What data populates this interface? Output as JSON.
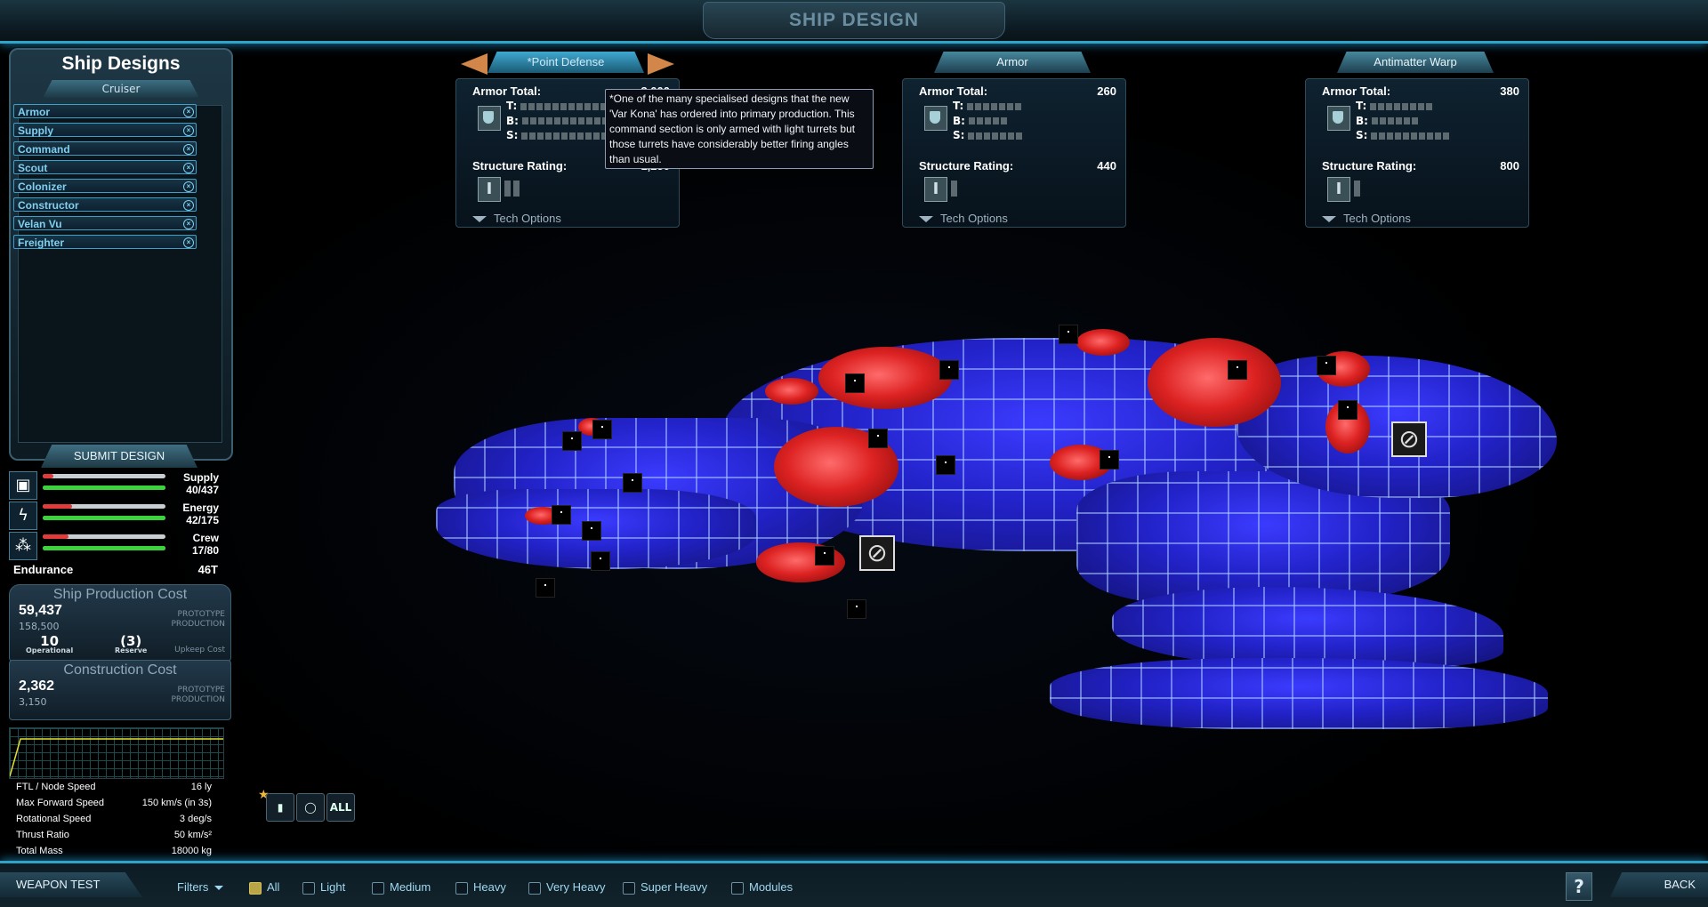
{
  "window": {
    "title": "SHIP DESIGN"
  },
  "designs_panel": {
    "title": "Ship Designs",
    "class_tab": "Cruiser",
    "items": [
      "Armor",
      "Supply",
      "Command",
      "Scout",
      "Colonizer",
      "Constructor",
      "Velan Vu",
      "Freighter"
    ],
    "submit_label": "SUBMIT DESIGN"
  },
  "resources": {
    "supply": {
      "label": "Supply",
      "value": "40/437",
      "top_fill": 0.09,
      "bottom_fill": 1.0
    },
    "energy": {
      "label": "Energy",
      "value": "42/175",
      "top_fill": 0.24,
      "bottom_fill": 1.0
    },
    "crew": {
      "label": "Crew",
      "value": "17/80",
      "top_fill": 0.21,
      "bottom_fill": 1.0
    }
  },
  "endurance": {
    "label": "Endurance",
    "value": "46T"
  },
  "ship_cost": {
    "title": "Ship Production Cost",
    "main": "59,437",
    "sub": "158,500",
    "proto_line1": "PROTOTYPE",
    "proto_line2": "PRODUCTION",
    "operational_value": "10",
    "operational_label": "Operational",
    "reserve_value": "(3)",
    "reserve_label": "Reserve",
    "upkeep_label": "Upkeep Cost"
  },
  "construction_cost": {
    "title": "Construction Cost",
    "main": "2,362",
    "sub": "3,150",
    "proto_line1": "PROTOTYPE",
    "proto_line2": "PRODUCTION"
  },
  "stats": [
    {
      "label": "FTL / Node Speed",
      "value": "16 ly"
    },
    {
      "label": "Max Forward Speed",
      "value": "150 km/s (in 3s)"
    },
    {
      "label": "Rotational Speed",
      "value": "3 deg/s"
    },
    {
      "label": "Thrust Ratio",
      "value": "50 km/s²"
    },
    {
      "label": "Total Mass",
      "value": "18000 kg"
    }
  ],
  "sections": [
    {
      "name": "*Point Defense",
      "armor_label": "Armor Total:",
      "armor_value": "3,000",
      "structure_label": "Structure Rating:",
      "structure_value": "1,250",
      "tech_label": "Tech Options",
      "t_pips": 12,
      "b_pips": 12,
      "s_pips": 12,
      "struct_pips": 2
    },
    {
      "name": "Armor",
      "armor_label": "Armor Total:",
      "armor_value": "260",
      "structure_label": "Structure Rating:",
      "structure_value": "440",
      "tech_label": "Tech Options",
      "t_pips": 7,
      "b_pips": 5,
      "s_pips": 7,
      "struct_pips": 1
    },
    {
      "name": "Antimatter Warp",
      "armor_label": "Armor Total:",
      "armor_value": "380",
      "structure_label": "Structure Rating:",
      "structure_value": "800",
      "tech_label": "Tech Options",
      "t_pips": 8,
      "b_pips": 6,
      "s_pips": 10,
      "struct_pips": 1
    }
  ],
  "tbs": {
    "t": "T:",
    "b": "B:",
    "s": "S:"
  },
  "tooltip": "*One of the many specialised designs that the new 'Var Kona' has ordered into primary production. This command section is only armed with light turrets but those turrets have considerably better firing angles than usual.",
  "weapon_filter_icons": {
    "all_label": "ALL"
  },
  "bottom": {
    "weapon_test": "WEAPON TEST",
    "filters": "Filters",
    "filter_items": [
      {
        "label": "All",
        "checked": true
      },
      {
        "label": "Light",
        "checked": false
      },
      {
        "label": "Medium",
        "checked": false
      },
      {
        "label": "Heavy",
        "checked": false
      },
      {
        "label": "Very Heavy",
        "checked": false
      },
      {
        "label": "Super Heavy",
        "checked": false
      },
      {
        "label": "Modules",
        "checked": false
      }
    ],
    "help": "?",
    "back": "BACK"
  },
  "colors": {
    "accent": "#2ea5c7",
    "hull": "#2222c8",
    "turret": "#d22222",
    "bar_fill": "#3bd23b",
    "bar_warn": "#e23b3b"
  }
}
